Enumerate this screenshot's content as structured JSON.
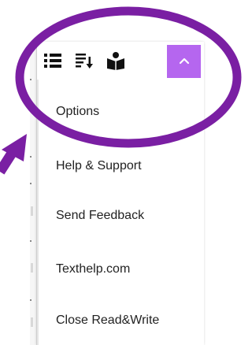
{
  "toolbar": {
    "icons": [
      "list-icon",
      "sort-icon",
      "reader-icon"
    ],
    "collapse_icon": "chevron-up-icon",
    "collapse_color": "#b566ef"
  },
  "menu": {
    "items": [
      {
        "label": "Options"
      },
      {
        "label": "Help & Support"
      },
      {
        "label": "Send Feedback"
      },
      {
        "label": "Texthelp.com"
      },
      {
        "label": "Close Read&Write"
      }
    ]
  },
  "annotation": {
    "color": "#7a1fa3"
  }
}
